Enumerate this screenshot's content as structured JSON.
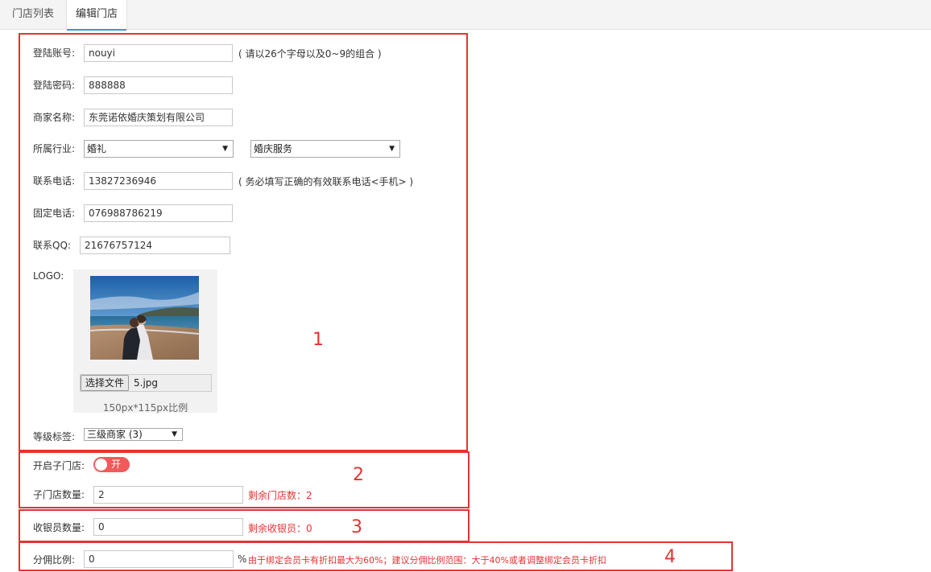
{
  "tabs": [
    {
      "label": "门店列表"
    },
    {
      "label": "编辑门店"
    }
  ],
  "form": {
    "account": {
      "label": "登陆账号:",
      "value": "nouyi",
      "hint": "( 请以26个字母以及0~9的组合 )"
    },
    "password": {
      "label": "登陆密码:",
      "value": "888888"
    },
    "merchant_name": {
      "label": "商家名称:",
      "value": "东莞诺依婚庆策划有限公司"
    },
    "industry": {
      "label": "所属行业:",
      "selected1": "婚礼",
      "selected2": "婚庆服务"
    },
    "phone": {
      "label": "联系电话:",
      "value": "13827236946",
      "hint": "( 务必填写正确的有效联系电话<手机> )"
    },
    "landline": {
      "label": "固定电话:",
      "value": "076988786219"
    },
    "qq": {
      "label": "联系QQ:",
      "value": "21676757124"
    },
    "logo": {
      "label": "LOGO:",
      "file_button": "选择文件",
      "file_name": "5.jpg",
      "ratio_hint": "150px*115px比例"
    },
    "level": {
      "label": "等级标签:",
      "selected": "三级商家 (3)"
    },
    "sub_store": {
      "label": "开启子门店:",
      "toggle_text": "开",
      "toggle_on": true
    },
    "sub_store_count": {
      "label": "子门店数量:",
      "value": "2",
      "remaining": "剩余门店数：2"
    },
    "cashier_count": {
      "label": "收银员数量:",
      "value": "0",
      "remaining": "剩余收银员：0"
    },
    "commission": {
      "label": "分佣比例:",
      "value": "0",
      "unit": "%",
      "note": "由于绑定会员卡有折扣最大为60%；建议分佣比例范围：大于40%或者调整绑定会员卡折扣"
    }
  },
  "annotations": [
    "1",
    "2",
    "3",
    "4"
  ],
  "colors": {
    "annotation_red": "#e53333",
    "toggle": "#f05a5a",
    "tab_accent": "#2a9be0"
  }
}
